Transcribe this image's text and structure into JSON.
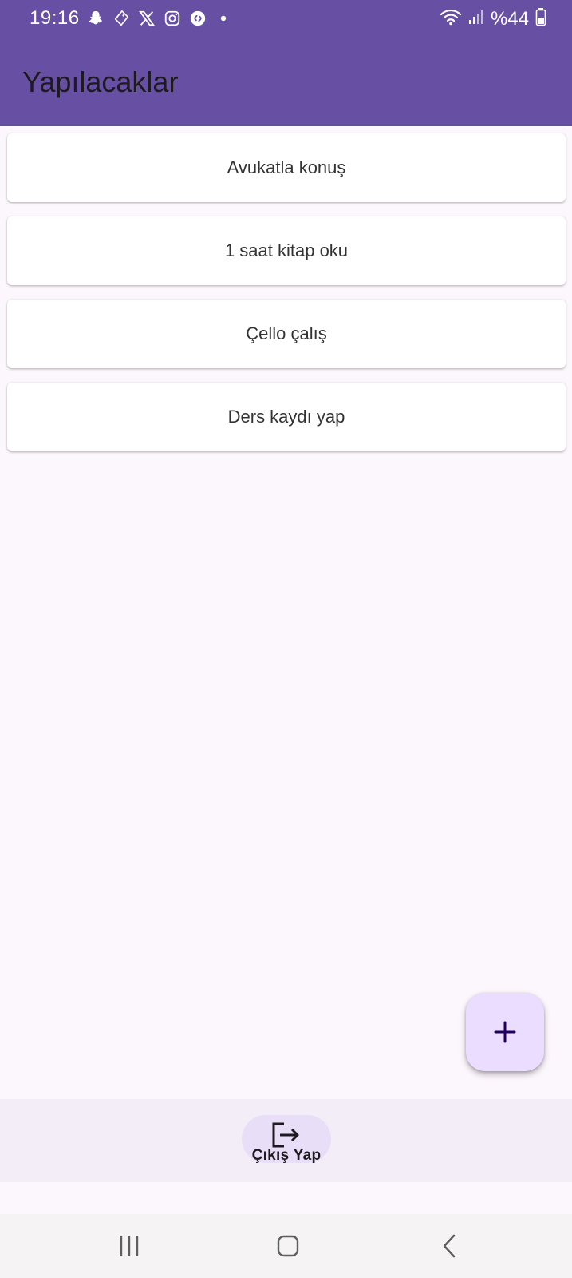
{
  "status_bar": {
    "time": "19:16",
    "battery": "%44",
    "left_icons": [
      "snapchat-icon",
      "tag-icon",
      "x-icon",
      "instagram-icon",
      "shazam-icon",
      "dot-icon"
    ],
    "right_icons": [
      "wifi-icon",
      "signal-icon",
      "battery-icon"
    ]
  },
  "app_bar": {
    "title": "Yapılacaklar",
    "color": "#6750a4"
  },
  "tasks": [
    {
      "label": "Avukatla konuş"
    },
    {
      "label": "1 saat kitap oku"
    },
    {
      "label": "Çello çalış"
    },
    {
      "label": "Ders kaydı yap"
    }
  ],
  "fab": {
    "icon": "plus-icon"
  },
  "bottom_nav": {
    "logout_label": "Çıkış Yap",
    "logout_icon": "logout-icon"
  },
  "system_nav": [
    "recent-apps-icon",
    "home-icon",
    "back-icon"
  ]
}
